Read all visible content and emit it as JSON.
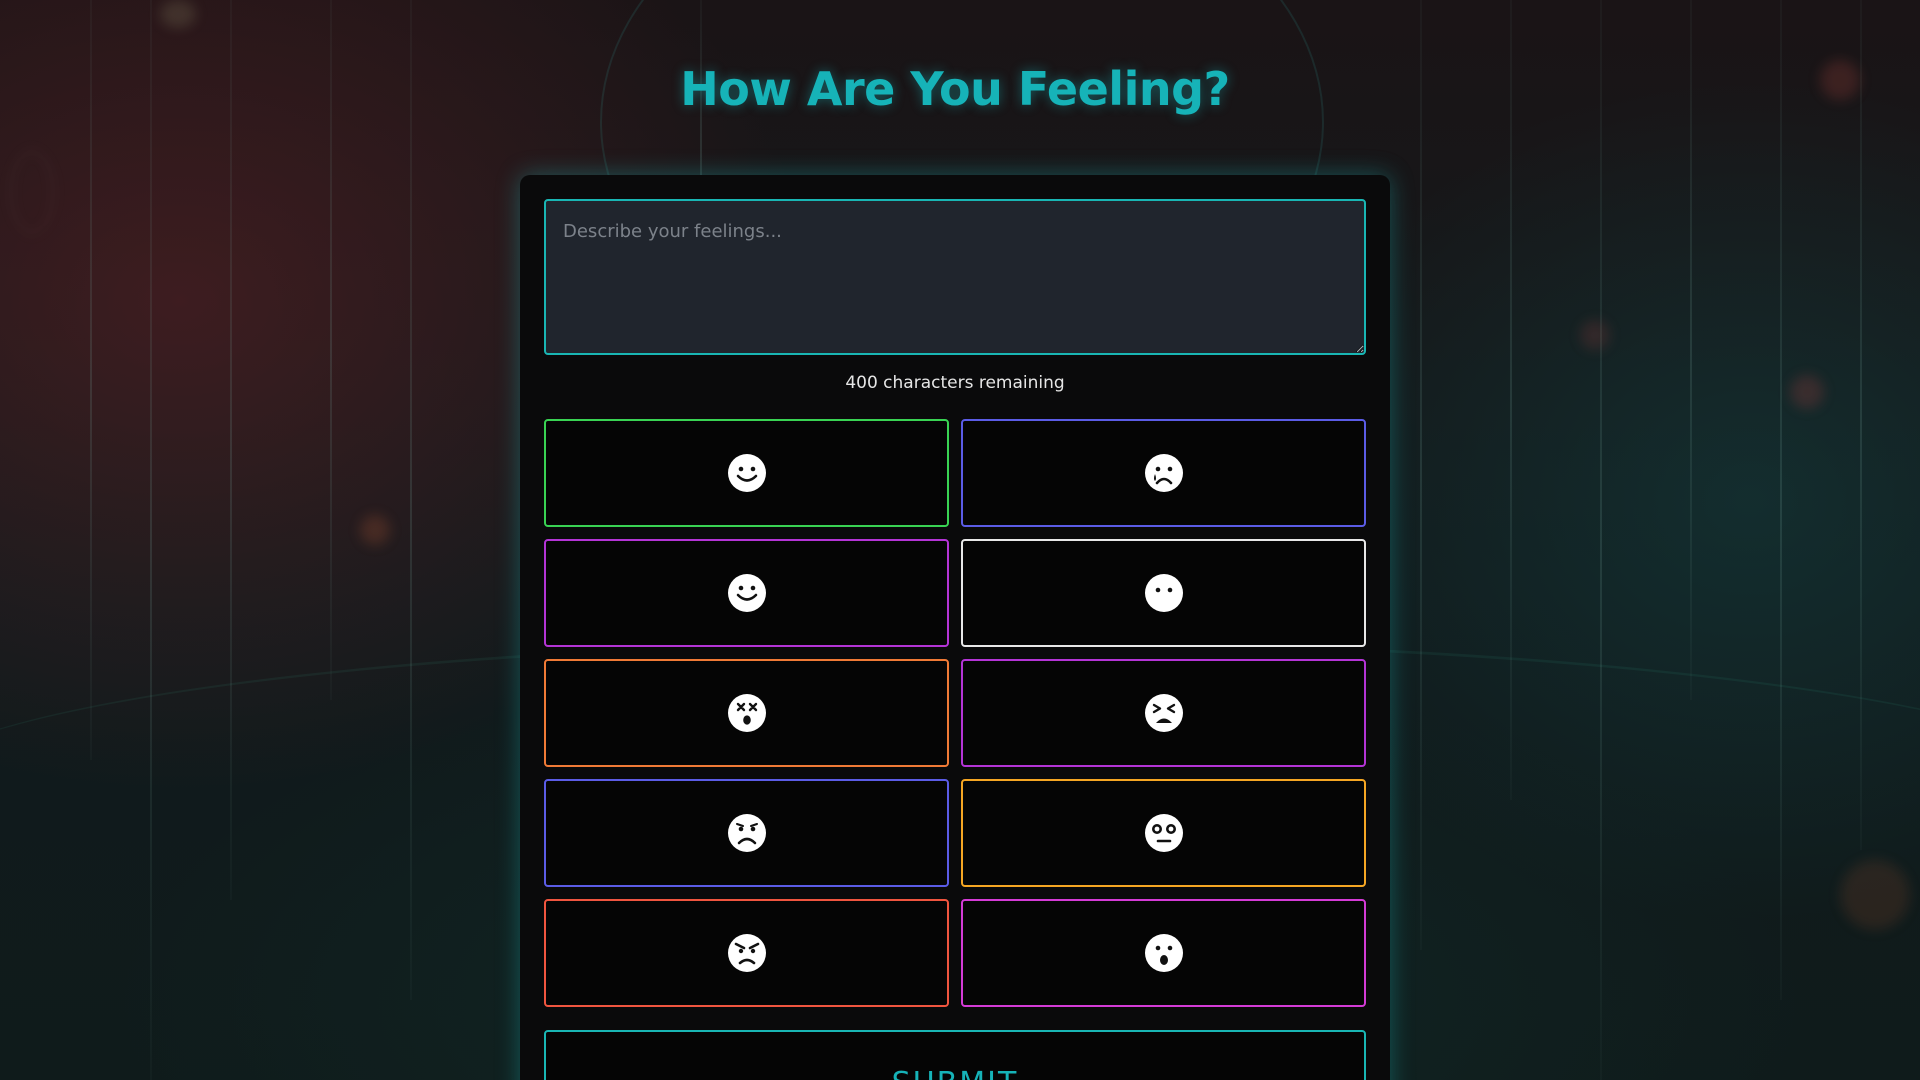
{
  "page": {
    "title": "How Are You Feeling?",
    "accent_color": "#16b3b8"
  },
  "form": {
    "feelings_placeholder": "Describe your feelings...",
    "feelings_value": "",
    "char_counter": "400 characters remaining",
    "submit_label": "SUBMIT"
  },
  "moods": [
    {
      "icon": "smiling-face-icon",
      "color": "#39d353"
    },
    {
      "icon": "crying-face-icon",
      "color": "#5b5ce6"
    },
    {
      "icon": "blushing-smile-icon",
      "color": "#b434d6"
    },
    {
      "icon": "neutral-face-icon",
      "color": "#e8e8e8"
    },
    {
      "icon": "dizzy-face-icon",
      "color": "#f07a36"
    },
    {
      "icon": "tired-face-icon",
      "color": "#b434d6"
    },
    {
      "icon": "sad-face-icon",
      "color": "#5b5ce6"
    },
    {
      "icon": "flushed-face-icon",
      "color": "#f5a623"
    },
    {
      "icon": "angry-face-icon",
      "color": "#f0553f"
    },
    {
      "icon": "surprised-face-icon",
      "color": "#d43bd6"
    }
  ]
}
